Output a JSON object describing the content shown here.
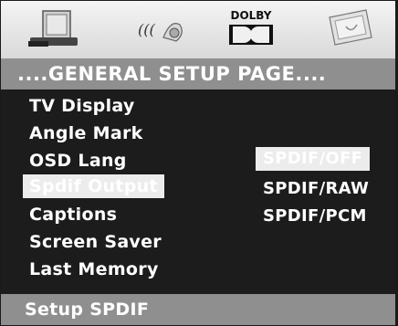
{
  "tabs": [
    {
      "name": "general-setup-tab",
      "icon": "general-setup-icon"
    },
    {
      "name": "audio-setup-tab",
      "icon": "speaker-audio-icon"
    },
    {
      "name": "dolby-setup-tab",
      "icon": "dolby-logo-icon",
      "label": "DOLBY"
    },
    {
      "name": "preference-setup-tab",
      "icon": "preference-icon"
    }
  ],
  "header": {
    "title": "....GENERAL SETUP PAGE...."
  },
  "menu": {
    "items": [
      {
        "label": "TV Display"
      },
      {
        "label": "Angle Mark"
      },
      {
        "label": "OSD Lang"
      },
      {
        "label": "Spdif Output",
        "selected": true
      },
      {
        "label": "Captions"
      },
      {
        "label": "Screen Saver"
      },
      {
        "label": "Last Memory"
      }
    ]
  },
  "options": {
    "items": [
      {
        "label": "SPDIF/OFF",
        "selected": true
      },
      {
        "label": "SPDIF/RAW"
      },
      {
        "label": "SPDIF/PCM"
      }
    ]
  },
  "footer": {
    "hint": "Setup SPDIF"
  },
  "colors": {
    "panel": "#1c1c1c",
    "bar": "#8f8f8f",
    "highlight": "#ececec",
    "text": "#ffffff"
  }
}
